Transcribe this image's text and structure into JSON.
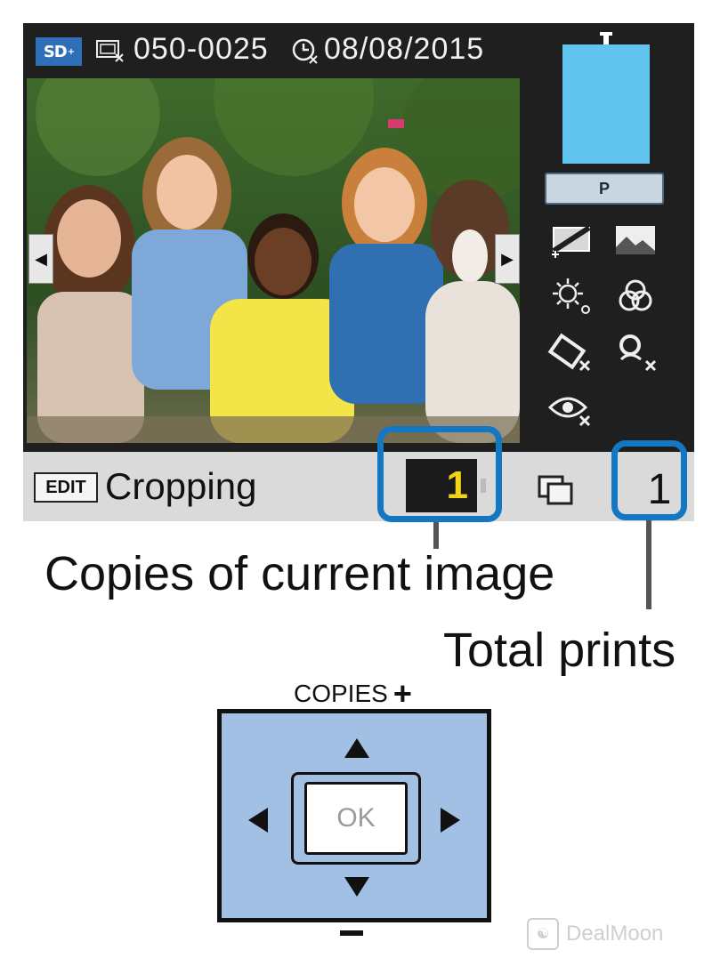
{
  "status": {
    "card_badge": "SD",
    "card_badge_suffix": "+",
    "image_number": "050-0025",
    "date": "08/08/2015"
  },
  "paper": {
    "mode_label": "P"
  },
  "bottom_bar": {
    "edit_tag": "EDIT",
    "edit_label": "Cropping",
    "copies_value": "1",
    "total_value": "1"
  },
  "callouts": {
    "copies_caption": "Copies of current image",
    "total_caption": "Total prints"
  },
  "dpad": {
    "top_label": "COPIES",
    "top_sign": "+",
    "ok_label": "OK"
  },
  "watermark": {
    "text": "DealMoon"
  },
  "colors": {
    "accent": "#1377c2",
    "paper": "#61c4ee",
    "dpad": "#a2c0e4",
    "copies_digit": "#f3d21a"
  },
  "icons": [
    "sd-card-icon",
    "image-number-icon",
    "date-icon",
    "left-arrow-icon",
    "right-arrow-icon",
    "layout-icon",
    "image-enhance-icon",
    "brightness-icon",
    "color-filter-icon",
    "hide-info-icon",
    "red-eye-off-icon",
    "eye-fix-icon",
    "print-stack-icon"
  ]
}
